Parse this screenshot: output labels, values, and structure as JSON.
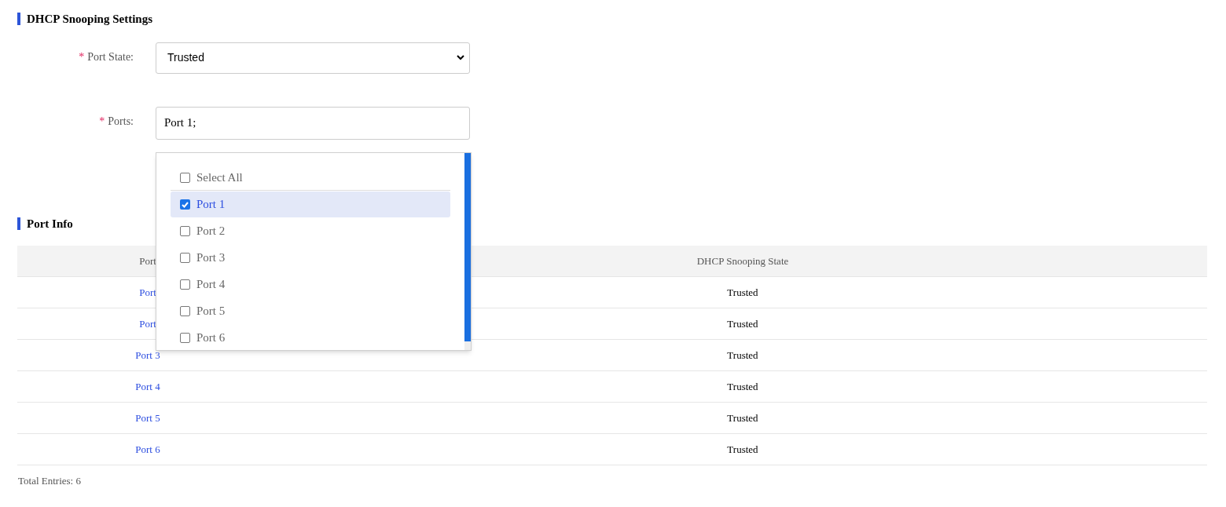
{
  "settings": {
    "title": "DHCP Snooping Settings",
    "fields": [
      {
        "kind": "select",
        "required_mark": "*",
        "label": "Port State:",
        "value": "Trusted"
      },
      {
        "kind": "text",
        "required_mark": "*",
        "label": "Ports:",
        "value": "Port 1;"
      }
    ]
  },
  "dropdown": {
    "options": [
      {
        "label": "Select All",
        "checked": false,
        "selected": false,
        "kind": "all"
      },
      {
        "label": "Port 1",
        "checked": true,
        "selected": true,
        "kind": "item"
      },
      {
        "label": "Port 2",
        "checked": false,
        "selected": false,
        "kind": "item"
      },
      {
        "label": "Port 3",
        "checked": false,
        "selected": false,
        "kind": "item"
      },
      {
        "label": "Port 4",
        "checked": false,
        "selected": false,
        "kind": "item"
      },
      {
        "label": "Port 5",
        "checked": false,
        "selected": false,
        "kind": "item"
      },
      {
        "label": "Port 6",
        "checked": false,
        "selected": false,
        "kind": "item"
      }
    ]
  },
  "port_info": {
    "title": "Port Info",
    "table": {
      "columns": [
        "Port",
        "DHCP Snooping State"
      ],
      "rows": [
        [
          "Port",
          "Trusted"
        ],
        [
          "Port",
          "Trusted"
        ],
        [
          "Port 3",
          "Trusted"
        ],
        [
          "Port 4",
          "Trusted"
        ],
        [
          "Port 5",
          "Trusted"
        ],
        [
          "Port 6",
          "Trusted"
        ]
      ]
    },
    "total": "Total Entries: 6"
  }
}
